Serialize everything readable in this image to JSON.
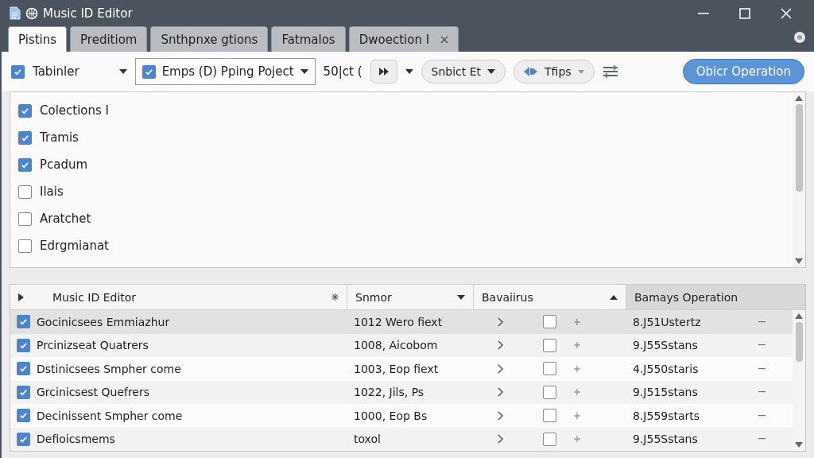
{
  "window": {
    "title": "Music ID Editor"
  },
  "tabs": [
    {
      "label": "Pistins",
      "selected": true,
      "closable": false
    },
    {
      "label": "Preditiom",
      "selected": false,
      "closable": false
    },
    {
      "label": "Snthpnxe gtions",
      "selected": false,
      "closable": false
    },
    {
      "label": "Fatmalos",
      "selected": false,
      "closable": false
    },
    {
      "label": "Dwoection I",
      "selected": false,
      "closable": true
    }
  ],
  "toolbar": {
    "filter": {
      "label": "Tabinler",
      "checked": true
    },
    "project": {
      "label": "Emps (D) Pping Poject",
      "checked": true
    },
    "count": "50|ct (",
    "select": "Snbict Et",
    "tips": "Tfips",
    "primary": "Obicr Operation"
  },
  "checklist": [
    {
      "label": "Colections I",
      "checked": true
    },
    {
      "label": "Tramis",
      "checked": true
    },
    {
      "label": "Pcadum",
      "checked": true
    },
    {
      "label": "Ilais",
      "checked": false
    },
    {
      "label": "Aratchet",
      "checked": false
    },
    {
      "label": "Edrgmianat",
      "checked": false
    }
  ],
  "table": {
    "columns": [
      "Music ID Editor",
      "Snmor",
      "Bavaiirus",
      "Bamays Operation"
    ],
    "rows": [
      {
        "checked": true,
        "name": "Gocinicsees Emmiazhur",
        "col_2": "1012 Wero fiext",
        "toggled": false,
        "value": "8.J51Ustertz",
        "selected": true
      },
      {
        "checked": true,
        "name": "Prcinizseat Quatrers",
        "col_2": "1008, Aicobom",
        "toggled": false,
        "value": "9.J55Sstans",
        "selected": false
      },
      {
        "checked": true,
        "name": "Dstinicsees Smpher come",
        "col_2": "1003, Eop fiext",
        "toggled": false,
        "value": "4.J550staris",
        "selected": false
      },
      {
        "checked": true,
        "name": "Grcinicsest Quefrers",
        "col_2": "1022, Jils, Ps",
        "toggled": false,
        "value": "9.J515stans",
        "selected": false
      },
      {
        "checked": true,
        "name": "Decinissent Smpher come",
        "col_2": "1000, Eop Bs",
        "toggled": false,
        "value": "8.J559starts",
        "selected": false
      },
      {
        "checked": true,
        "name": "Defioicsmems",
        "col_2": "toxol",
        "toggled": false,
        "value": "9.J55Sstans",
        "selected": false
      }
    ]
  }
}
